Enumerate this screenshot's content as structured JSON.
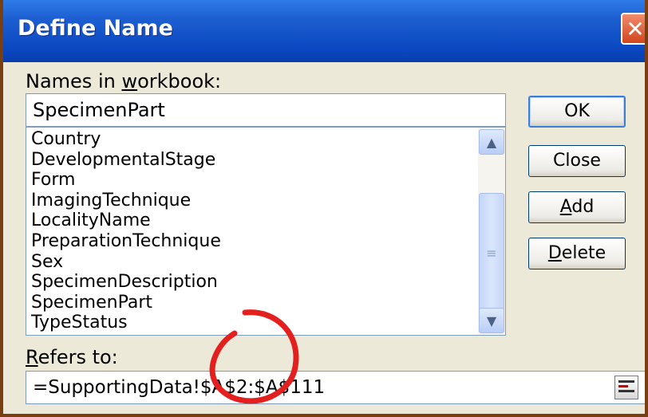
{
  "window": {
    "title": "Define Name"
  },
  "names_label": "Names in workbook:",
  "name_input": {
    "value": "SpecimenPart"
  },
  "names_list": [
    "Country",
    "DevelopmentalStage",
    "Form",
    "ImagingTechnique",
    "LocalityName",
    "PreparationTechnique",
    "Sex",
    "SpecimenDescription",
    "SpecimenPart",
    "TypeStatus"
  ],
  "buttons": {
    "ok": "OK",
    "close": "Close",
    "add": "Add",
    "delete": "Delete"
  },
  "refers_label": "Refers to:",
  "refers_input": {
    "value": "=SupportingData!$A$2:$A$111"
  },
  "colors": {
    "titlebar": "#0a47c0",
    "annotation": "#e4201f"
  },
  "icons": {
    "close": "close-icon",
    "scroll_up": "chevron-up-icon",
    "scroll_down": "chevron-down-icon",
    "collapse": "collapse-dialog-icon"
  }
}
